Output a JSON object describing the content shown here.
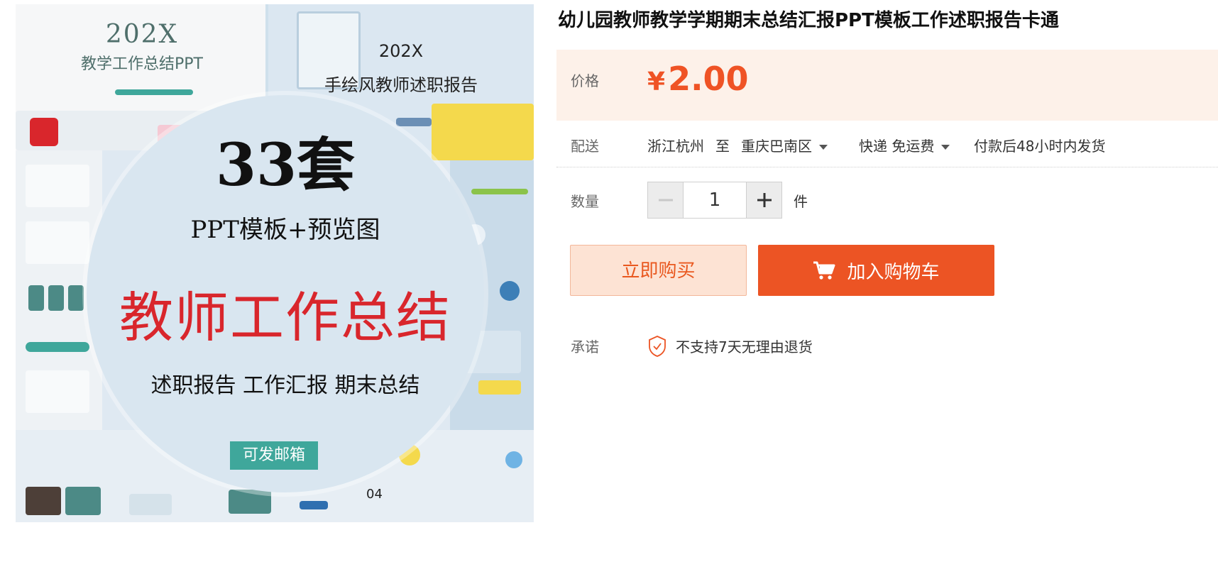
{
  "product_image": {
    "left_card": {
      "year": "202X",
      "subtitle": "教学工作总结PPT"
    },
    "right_card": {
      "year": "202X",
      "subtitle": "手绘风教师述职报告"
    },
    "count_text": "33套",
    "ppt_text": "PPT模板+预览图",
    "main_title": "教师工作总结",
    "tags_text": "述职报告 工作汇报 期末总结",
    "badge_text": "可发邮箱",
    "page_number": "04"
  },
  "product": {
    "title": "幼儿园教师教学学期期末总结汇报PPT模板工作述职报告卡通"
  },
  "price": {
    "label": "价格",
    "currency": "¥",
    "amount": "2.00"
  },
  "shipping": {
    "label": "配送",
    "from": "浙江杭州",
    "to_word": "至",
    "destination": "重庆巴南区",
    "method": "快递 免运费",
    "delivery_note": "付款后48小时内发货"
  },
  "quantity": {
    "label": "数量",
    "value": "1",
    "unit": "件"
  },
  "actions": {
    "buy_now_label": "立即购买",
    "add_cart_label": "加入购物车"
  },
  "promise": {
    "label": "承诺",
    "text": "不支持7天无理由退货"
  },
  "colors": {
    "accent": "#ec5424",
    "price": "#ef5325",
    "price_bg": "#fdf1e9",
    "main_title": "#d9262c",
    "badge": "#3fa79b"
  }
}
